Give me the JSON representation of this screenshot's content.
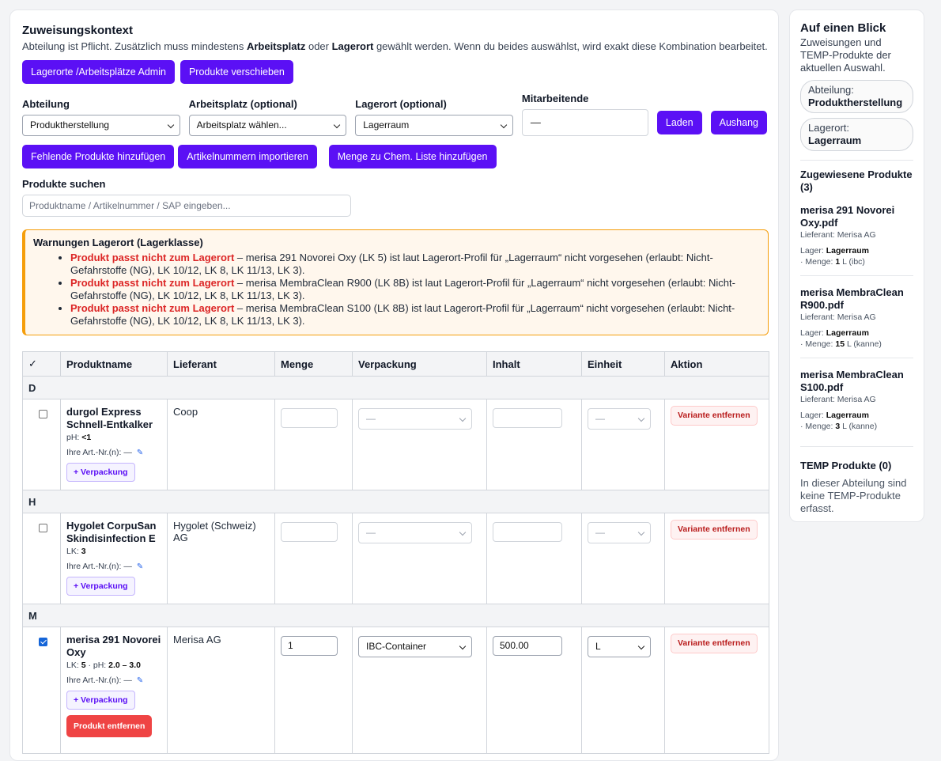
{
  "context": {
    "title": "Zuweisungskontext",
    "intro_1": "Abteilung ist Pflicht. Zusätzlich muss mindestens ",
    "intro_b1": "Arbeitsplatz",
    "intro_2": " oder ",
    "intro_b2": "Lagerort",
    "intro_3": " gewählt werden. Wenn du beides auswählst, wird exakt diese Kombination bearbeitet.",
    "btn_admin": "Lagerorte /Arbeitsplätze Admin",
    "btn_move": "Produkte verschieben"
  },
  "filters": {
    "abteilung_label": "Abteilung",
    "abteilung_value": "Produktherstellung",
    "arbeitsplatz_label": "Arbeitsplatz (optional)",
    "arbeitsplatz_value": "Arbeitsplatz wählen...",
    "lagerort_label": "Lagerort (optional)",
    "lagerort_value": "Lagerraum",
    "mitarbeitende_label": "Mitarbeitende",
    "mitarbeitende_value": "—",
    "btn_load": "Laden",
    "btn_aushang": "Aushang"
  },
  "actions": {
    "btn_missing": "Fehlende Produkte hinzufügen",
    "btn_import": "Artikelnummern importieren",
    "btn_chem": "Menge zu Chem. Liste hinzufügen"
  },
  "search": {
    "label": "Produkte suchen",
    "placeholder": "Produktname / Artikelnummer / SAP eingeben..."
  },
  "warnings": {
    "title": "Warnungen Lagerort (Lagerklasse)",
    "items": [
      {
        "tag": "Produkt passt nicht zum Lagerort",
        "text": " – merisa 291 Novorei Oxy (LK 5) ist laut Lagerort-Profil für „Lagerraum“ nicht vorgesehen (erlaubt: Nicht-Gefahrstoffe (NG), LK 10/12, LK 8, LK 11/13, LK 3)."
      },
      {
        "tag": "Produkt passt nicht zum Lagerort",
        "text": " – merisa MembraClean R900 (LK 8B) ist laut Lagerort-Profil für „Lagerraum“ nicht vorgesehen (erlaubt: Nicht-Gefahrstoffe (NG), LK 10/12, LK 8, LK 11/13, LK 3)."
      },
      {
        "tag": "Produkt passt nicht zum Lagerort",
        "text": " – merisa MembraClean S100 (LK 8B) ist laut Lagerort-Profil für „Lagerraum“ nicht vorgesehen (erlaubt: Nicht-Gefahrstoffe (NG), LK 10/12, LK 8, LK 11/13, LK 3)."
      }
    ]
  },
  "table": {
    "headers": [
      "✓",
      "Produktname",
      "Lieferant",
      "Menge",
      "Verpackung",
      "Inhalt",
      "Einheit",
      "Aktion"
    ],
    "groups": [
      {
        "letter": "D",
        "product": {
          "name": "durgol Express Schnell-Entkalker",
          "meta_label": "pH: ",
          "meta_value": "<1",
          "artnr": "Ihre Art.-Nr.(n): —",
          "supplier": "Coop",
          "menge": "",
          "verpackung": "—",
          "inhalt": "",
          "einheit": "—",
          "checked": false
        }
      },
      {
        "letter": "H",
        "product": {
          "name": "Hygolet CorpuSan Skindisinfection E",
          "meta_label": "LK: ",
          "meta_value": "3",
          "artnr": "Ihre Art.-Nr.(n): —",
          "supplier": "Hygolet (Schweiz) AG",
          "menge": "",
          "verpackung": "—",
          "inhalt": "",
          "einheit": "—",
          "checked": false
        }
      },
      {
        "letter": "M",
        "product": {
          "name": "merisa 291 Novorei Oxy",
          "meta_label": "LK: ",
          "meta_value": "5",
          "meta_label2": " · pH: ",
          "meta_value2": "2.0 – 3.0",
          "artnr": "Ihre Art.-Nr.(n): —",
          "supplier": "Merisa AG",
          "menge": "1",
          "verpackung": "IBC-Container",
          "inhalt": "500.00",
          "einheit": "L",
          "checked": true
        }
      }
    ],
    "btn_add_pack": "+ Verpackung",
    "btn_remove_variant": "Variante entfernen",
    "btn_remove_product": "Produkt entfernen"
  },
  "sidebar": {
    "title": "Auf einen Blick",
    "subtitle": "Zuweisungen und TEMP-Produkte der aktuellen Auswahl.",
    "dept_label": "Abteilung:",
    "dept_value": "Produktherstellung",
    "loc_label": "Lagerort:",
    "loc_value": "Lagerraum",
    "assigned_title": "Zugewiesene Produkte (3)",
    "assigned": [
      {
        "name": "merisa 291 Novorei Oxy.pdf",
        "supplier": "Lieferant: Merisa AG",
        "lager_label": "Lager: ",
        "lager": "Lagerraum",
        "menge_label": "· Menge: ",
        "menge": "1",
        "unit": " L (ibc)"
      },
      {
        "name": "merisa MembraClean R900.pdf",
        "supplier": "Lieferant: Merisa AG",
        "lager_label": "Lager: ",
        "lager": "Lagerraum",
        "menge_label": "· Menge: ",
        "menge": "15",
        "unit": " L (kanne)"
      },
      {
        "name": "merisa MembraClean S100.pdf",
        "supplier": "Lieferant: Merisa AG",
        "lager_label": "Lager: ",
        "lager": "Lagerraum",
        "menge_label": "· Menge: ",
        "menge": "3",
        "unit": " L (kanne)"
      }
    ],
    "temp_title": "TEMP Produkte (0)",
    "temp_text": "In dieser Abteilung sind keine TEMP-Produkte erfasst."
  },
  "colors": {
    "primary": "#5b10f5",
    "danger": "#ef4444",
    "warning_border": "#f59e0b",
    "warning_bg": "#fff7ed"
  }
}
